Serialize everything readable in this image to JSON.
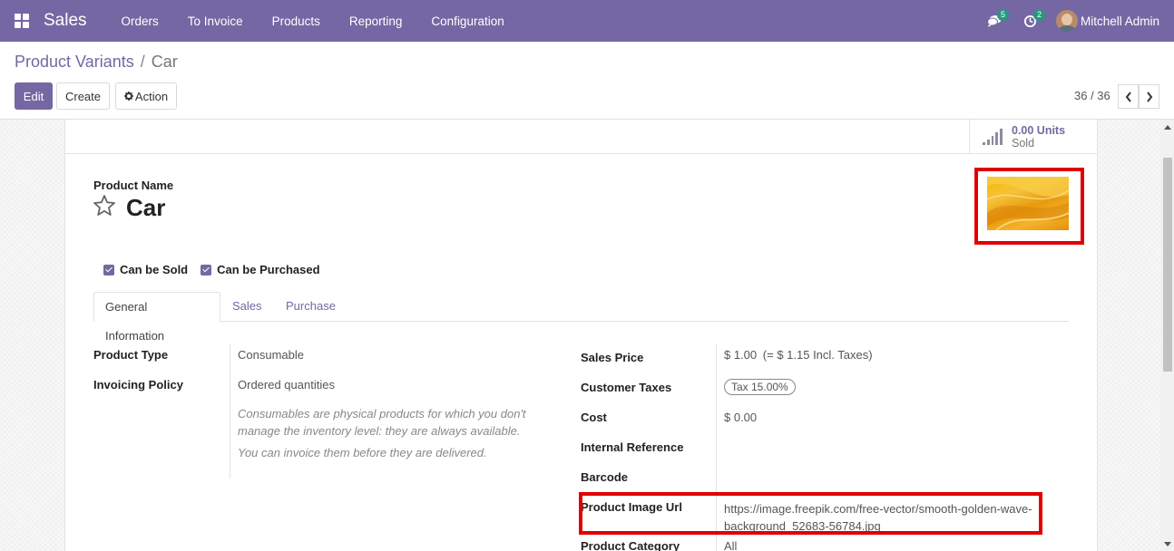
{
  "nav": {
    "app_name": "Sales",
    "menu": [
      "Orders",
      "To Invoice",
      "Products",
      "Reporting",
      "Configuration"
    ],
    "messages_count": "5",
    "activities_count": "2",
    "user_name": "Mitchell Admin"
  },
  "breadcrumb": {
    "parent": "Product Variants",
    "separator": "/",
    "current": "Car"
  },
  "toolbar": {
    "edit_label": "Edit",
    "create_label": "Create",
    "action_label": "Action"
  },
  "pager": {
    "value": "36 / 36"
  },
  "stat": {
    "value": "0.00 Units",
    "label": "Sold"
  },
  "product": {
    "name_label": "Product Name",
    "name": "Car",
    "can_be_sold": "Can be Sold",
    "can_be_purchased": "Can be Purchased"
  },
  "tabs": [
    "General Information",
    "Sales",
    "Purchase"
  ],
  "left_fields": [
    {
      "label": "Product Type",
      "value": "Consumable"
    },
    {
      "label": "Invoicing Policy",
      "value": "Ordered quantities"
    }
  ],
  "help_text": {
    "line1": "Consumables are physical products for which you don't",
    "line2": "manage the inventory level: they are always available.",
    "line3": "You can invoice them before they are delivered."
  },
  "right_fields": {
    "sales_price_label": "Sales Price",
    "sales_price_value": "$ 1.00",
    "sales_price_incl": "(= $ 1.15 Incl. Taxes)",
    "customer_taxes_label": "Customer Taxes",
    "customer_taxes_tag": "Tax 15.00%",
    "cost_label": "Cost",
    "cost_value": "$ 0.00",
    "internal_ref_label": "Internal Reference",
    "barcode_label": "Barcode",
    "image_url_label": "Product Image Url",
    "image_url_line1": "https://image.freepik.com/free-vector/smooth-golden-wave-",
    "image_url_line2": "background_52683-56784.jpg",
    "category_label": "Product Category",
    "category_value": "All"
  },
  "colors": {
    "brand": "#7567a3",
    "highlight": "#e00000"
  }
}
